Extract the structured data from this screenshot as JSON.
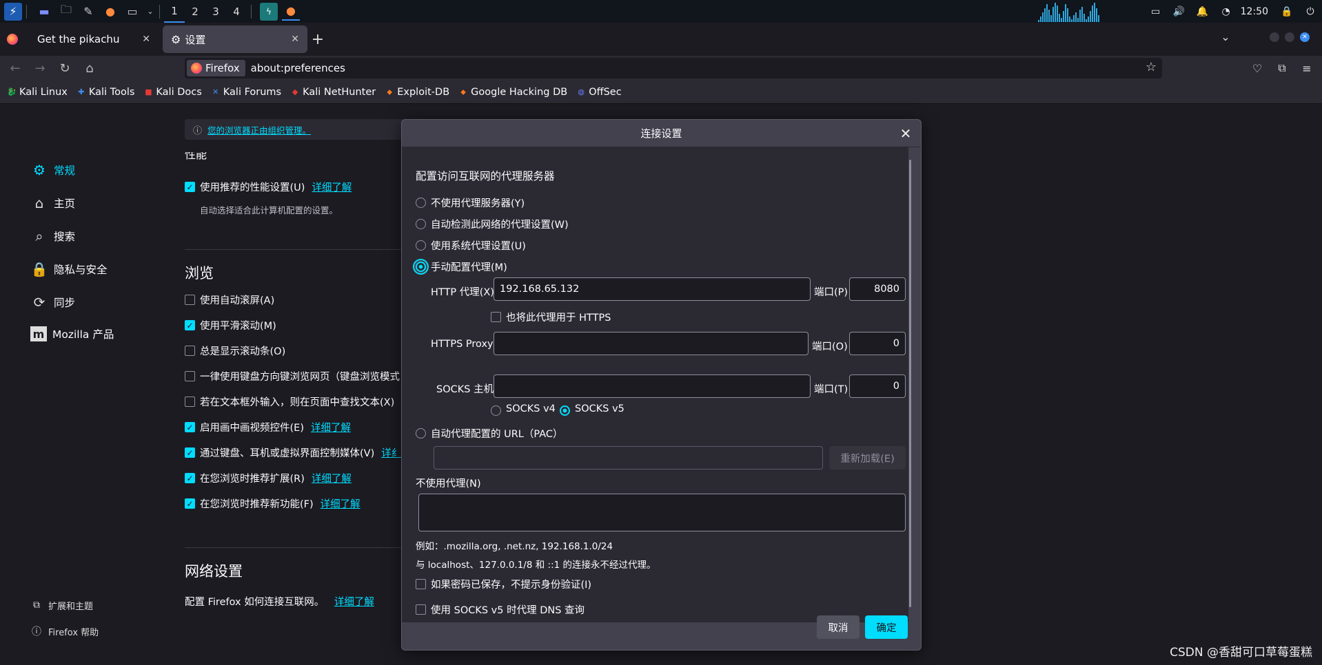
{
  "taskbar": {
    "workspaces": [
      "1",
      "2",
      "3",
      "4"
    ],
    "time": "12:50"
  },
  "tabs": [
    {
      "label": "Get the pikachu"
    },
    {
      "label": "设置"
    }
  ],
  "urlbar": {
    "identity": "Firefox",
    "url": "about:preferences"
  },
  "bookmarks": [
    {
      "label": "Kali Linux"
    },
    {
      "label": "Kali Tools"
    },
    {
      "label": "Kali Docs"
    },
    {
      "label": "Kali Forums"
    },
    {
      "label": "Kali NetHunter"
    },
    {
      "label": "Exploit-DB"
    },
    {
      "label": "Google Hacking DB"
    },
    {
      "label": "OffSec"
    }
  ],
  "prefs": {
    "banner": "您的浏览器正由组织管理。",
    "categories": [
      "常规",
      "主页",
      "搜索",
      "隐私与安全",
      "同步",
      "Mozilla 产品"
    ],
    "footer": [
      "扩展和主题",
      "Firefox 帮助"
    ],
    "perf_heading_partial": "性能",
    "perf_option": "使用推荐的性能设置(U)",
    "perf_sub": "自动选择适合此计算机配置的设置。",
    "learn_more": "详细了解",
    "browse_heading": "浏览",
    "browse_options": [
      {
        "label": "使用自动滚屏(A)",
        "checked": false
      },
      {
        "label": "使用平滑滚动(M)",
        "checked": true
      },
      {
        "label": "总是显示滚动条(O)",
        "checked": false
      },
      {
        "label": "一律使用键盘方向键浏览网页（键盘浏览模式",
        "checked": false
      },
      {
        "label": "若在文本框外输入，则在页面中查找文本(X)",
        "checked": false
      },
      {
        "label": "启用画中画视频控件(E)",
        "checked": true
      },
      {
        "label": "通过键盘、耳机或虚拟界面控制媒体(V)",
        "checked": true
      },
      {
        "label": "在您浏览时推荐扩展(R)",
        "checked": true
      },
      {
        "label": "在您浏览时推荐新功能(F)",
        "checked": true
      }
    ],
    "learn_more_partial": "详纟",
    "network_heading": "网络设置",
    "network_desc": "配置 Firefox 如何连接互联网。"
  },
  "dialog": {
    "title": "连接设置",
    "heading": "配置访问互联网的代理服务器",
    "options": {
      "no_proxy": "不使用代理服务器(Y)",
      "auto_detect": "自动检测此网络的代理设置(W)",
      "system": "使用系统代理设置(U)",
      "manual": "手动配置代理(M)",
      "pac": "自动代理配置的 URL（PAC）"
    },
    "http_label": "HTTP 代理(X)",
    "http_value": "192.168.65.132",
    "port_label_p": "端口(P)",
    "http_port": "8080",
    "also_https": "也将此代理用于 HTTPS",
    "https_label": "HTTPS Proxy",
    "port_label_o": "端口(O)",
    "https_port": "0",
    "socks_label": "SOCKS 主机",
    "port_label_t": "端口(T)",
    "socks_port": "0",
    "socks_v4": "SOCKS v4",
    "socks_v5": "SOCKS v5",
    "reload": "重新加载(E)",
    "no_proxy_for": "不使用代理(N)",
    "example": "例如：.mozilla.org, .net.nz, 192.168.1.0/24",
    "localhost_note": "与 localhost、127.0.0.1/8 和 ::1 的连接永不经过代理。",
    "no_auth_prompt": "如果密码已保存，不提示身份验证(I)",
    "socks_dns": "使用 SOCKS v5 时代理 DNS 查询",
    "cancel": "取消",
    "ok": "确定"
  },
  "watermark": "CSDN @香甜可口草莓蛋糕",
  "colors": {
    "accent": "#00ddff",
    "dialog_bg": "#42414d",
    "page_bg": "#1c1b22"
  }
}
